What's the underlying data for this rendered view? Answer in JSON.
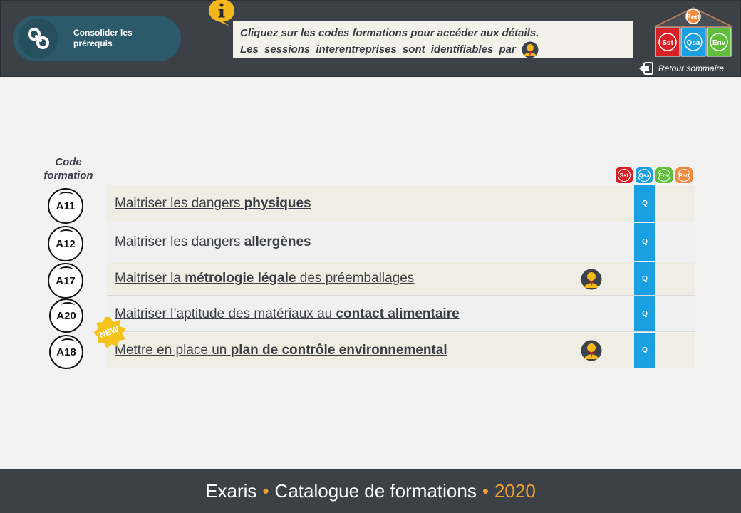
{
  "header": {
    "pill_label": "Consolider les prérequis",
    "info_line1": "Cliquez sur les codes formations pour accéder aux détails.",
    "info_line2": "Les sessions interentreprises sont identifiables par",
    "back_label": "Retour sommaire"
  },
  "categories": {
    "top": "Pert",
    "items": [
      {
        "label": "Sst",
        "color": "#d92027"
      },
      {
        "label": "Qsa",
        "color": "#1aa0e2"
      },
      {
        "label": "Env",
        "color": "#5fbf3b"
      },
      {
        "label": "Pert",
        "color": "#f08a40"
      }
    ]
  },
  "table": {
    "code_header": "Code formation",
    "rows": [
      {
        "code": "A11",
        "pre": "Maitriser les dangers ",
        "bold": "physiques",
        "post": "",
        "inter": false,
        "cat": "Q"
      },
      {
        "code": "A12",
        "pre": "Maitriser les dangers ",
        "bold": "allergènes",
        "post": "",
        "inter": false,
        "cat": "Q"
      },
      {
        "code": "A17",
        "pre": "Maitriser la ",
        "bold": "métrologie légale",
        "post": " des préemballages",
        "inter": true,
        "cat": "Q"
      },
      {
        "code": "A20",
        "pre": "Maitriser l’aptitude des matériaux au ",
        "bold": "contact alimentaire",
        "post": "",
        "inter": false,
        "cat": "Q"
      },
      {
        "code": "A18",
        "pre": "Mettre en place un ",
        "bold": "plan de contrôle environnemental",
        "post": "",
        "inter": true,
        "cat": "Q"
      }
    ],
    "new_label": "NEW"
  },
  "footer": {
    "brand": "Exaris",
    "sep": "•",
    "title": "Catalogue de formations",
    "year": "2020"
  }
}
